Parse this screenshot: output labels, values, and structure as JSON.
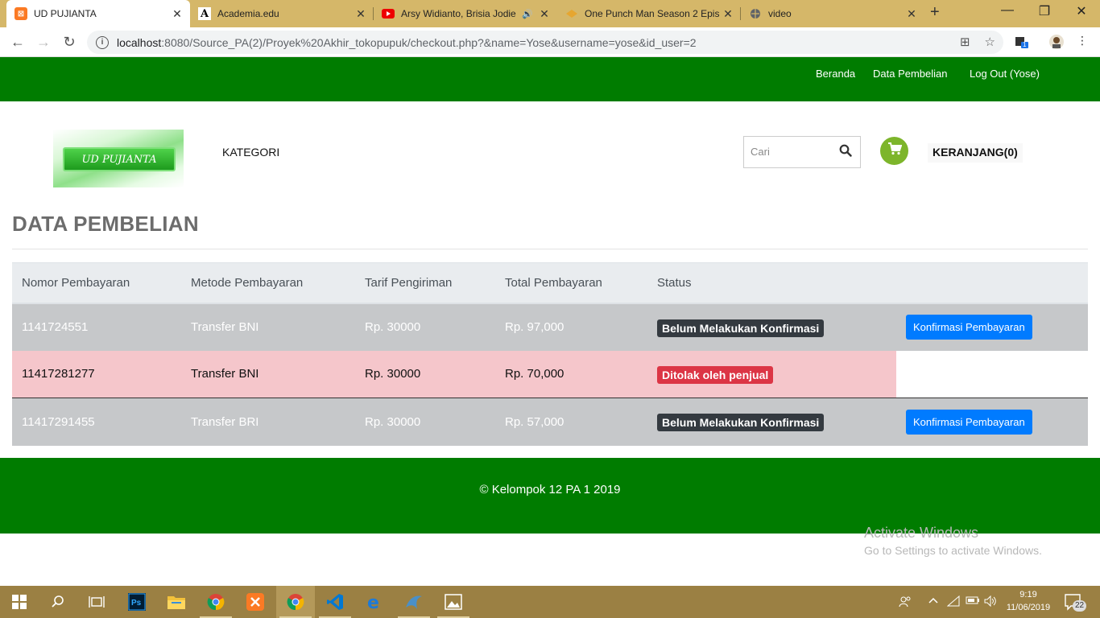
{
  "browser": {
    "tabs": [
      {
        "title": "UD PUJIANTA",
        "icon": "xampp-icon"
      },
      {
        "title": "Academia.edu",
        "icon": "academia-icon"
      },
      {
        "title": "Arsy Widianto, Brisia Jodie",
        "icon": "youtube-icon"
      },
      {
        "title": "One Punch Man Season 2 Epis",
        "icon": "site-icon"
      },
      {
        "title": "video",
        "icon": "globe-icon"
      }
    ],
    "url_host": "localhost",
    "url_rest": ":8080/Source_PA(2)/Proyek%20Akhir_tokopupuk/checkout.php?&name=Yose&username=yose&id_user=2",
    "extension_badge": "1"
  },
  "nav": {
    "beranda": "Beranda",
    "data_pembelian": "Data Pembelian",
    "logout": "Log Out (Yose)"
  },
  "logo_text": "UD PUJIANTA",
  "kategori": "KATEGORI",
  "search": {
    "placeholder": "Cari"
  },
  "cart_label": "KERANJANG(0)",
  "page_title": "DATA PEMBELIAN",
  "table": {
    "headers": [
      "Nomor Pembayaran",
      "Metode Pembayaran",
      "Tarif Pengiriman",
      "Total Pembayaran",
      "Status"
    ],
    "rows": [
      {
        "nomor": "1141724551",
        "metode": "Transfer BNI",
        "tarif": "Rp. 30000",
        "total": "Rp. 97,000",
        "status": "Belum Melakukan Konfirmasi",
        "action": "Konfirmasi Pembayaran"
      },
      {
        "nomor": "11417281277",
        "metode": "Transfer BNI",
        "tarif": "Rp. 30000",
        "total": "Rp. 70,000",
        "status": "Ditolak oleh penjual",
        "action": ""
      },
      {
        "nomor": "11417291455",
        "metode": "Transfer BRI",
        "tarif": "Rp. 30000",
        "total": "Rp. 57,000",
        "status": "Belum Melakukan Konfirmasi",
        "action": "Konfirmasi Pembayaran"
      }
    ]
  },
  "footer": "© Kelompok 12 PA 1 2019",
  "watermark": {
    "line1": "Activate Windows",
    "line2": "Go to Settings to activate Windows."
  },
  "taskbar": {
    "time": "9:19",
    "date": "11/06/2019",
    "notifications": "22"
  },
  "colors": {
    "header_green": "#007c00",
    "badge_dark": "#343a40",
    "badge_danger": "#dc3545",
    "primary": "#007bff",
    "cart_green": "#7db52b"
  }
}
